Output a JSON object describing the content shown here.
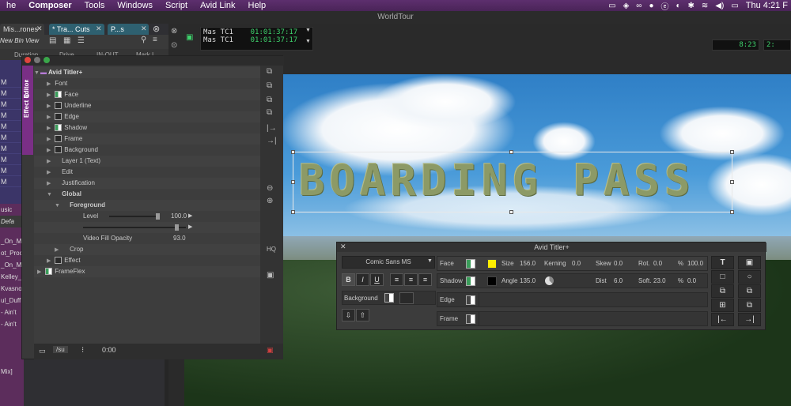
{
  "menubar": {
    "items": [
      "he",
      "Composer",
      "Tools",
      "Windows",
      "Script",
      "Avid Link",
      "Help"
    ],
    "clock": "Thu 4:21 F"
  },
  "window": {
    "title": "WorldTour"
  },
  "bin": {
    "tabs": [
      "Mis...rones",
      "* Tra... Cuts",
      "P...s"
    ],
    "view_name": "New Bin View",
    "columns": [
      "Duration",
      "Drive",
      "IN-OUT",
      "Mark I"
    ],
    "rows": [
      "M",
      "M",
      "M",
      "M",
      "M",
      "M",
      "M",
      "M",
      "M",
      "M"
    ],
    "rows2": [
      "usic",
      "Defa",
      "_On_M",
      "ot_Proc",
      "_On_M",
      "Kelley_",
      "Kvasnov",
      "ul_Duff",
      "- Ain't",
      "- Ain't",
      "",
      "",
      "",
      "Mix]"
    ]
  },
  "monitor": {
    "tc1_label": "Mas TC1",
    "tc1_value": "01:01:37:17",
    "tc2_label": "Mas TC1",
    "tc2_value": "01:01:37:17",
    "readout_a": "8:23",
    "readout_b": "2:"
  },
  "effect_editor": {
    "side_label": "Effect Editor",
    "root": "Avid Titler+",
    "items": [
      "Font",
      "Face",
      "Underline",
      "Edge",
      "Shadow",
      "Frame",
      "Background",
      "Layer 1 (Text)",
      "Edit",
      "Justification",
      "Global",
      "Foreground",
      "Level",
      "",
      "Video Fill Opacity",
      "Crop",
      "Effect",
      "FrameFlex"
    ],
    "level_value": "100.0",
    "opacity_value": "93.0",
    "footer_time": "0:00",
    "footer_tab": "/su"
  },
  "title_text": "BOARDING PASS",
  "titler": {
    "header": "Avid Titler+",
    "font": "Comic Sans MS",
    "face_label": "Face",
    "shadow_label": "Shadow",
    "edge_label": "Edge",
    "frame_label": "Frame",
    "background_label": "Background",
    "size_label": "Size",
    "size_value": "156.0",
    "kerning_label": "Kerning",
    "kerning_value": "0.0",
    "skew_label": "Skew",
    "skew_value": "0.0",
    "rot_label": "Rot.",
    "rot_value": "0.0",
    "pct_label": "%",
    "pct_value": "100.0",
    "angle_label": "Angle",
    "angle_value": "135.0",
    "dist_label": "Dist",
    "dist_value": "6.0",
    "soft_label": "Soft.",
    "soft_value": "23.0",
    "pct2_label": "%",
    "pct2_value": "0.0",
    "face_color": "#ffee00",
    "shadow_color": "#000000"
  }
}
